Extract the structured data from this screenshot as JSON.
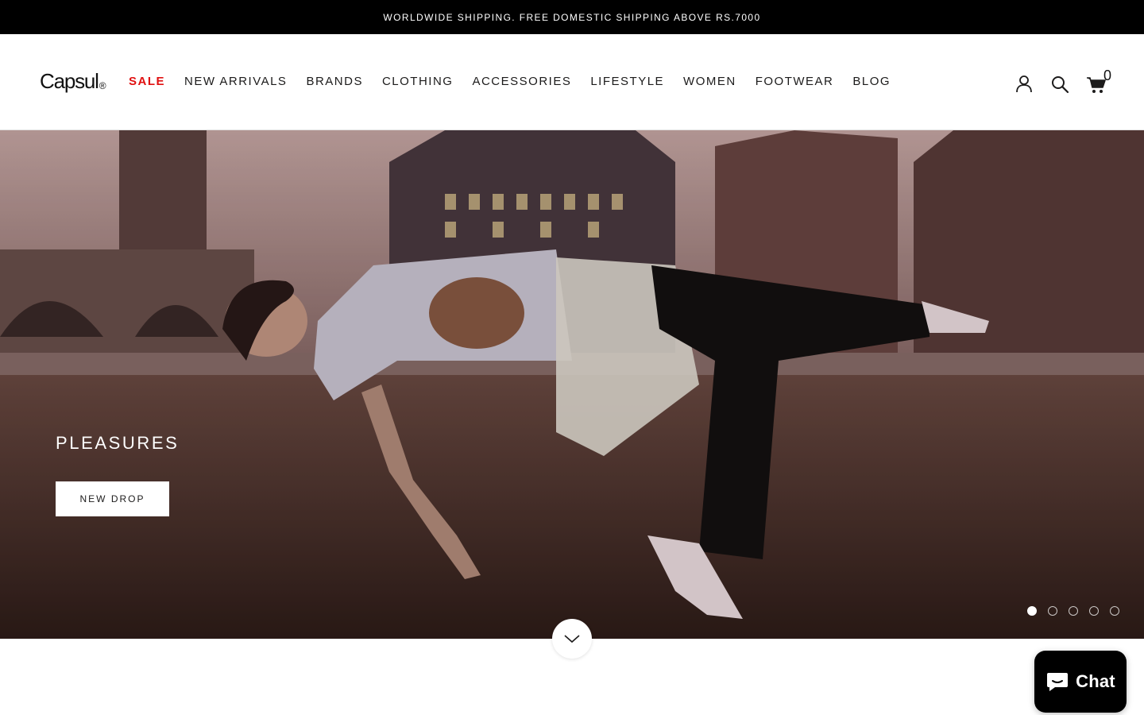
{
  "announcement": {
    "text": "WORLDWIDE SHIPPING. FREE DOMESTIC SHIPPING ABOVE RS.7000"
  },
  "header": {
    "logo": "Capsul",
    "logo_mark": "®",
    "nav": [
      {
        "label": "SALE"
      },
      {
        "label": "NEW ARRIVALS"
      },
      {
        "label": "BRANDS"
      },
      {
        "label": "CLOTHING"
      },
      {
        "label": "ACCESSORIES"
      },
      {
        "label": "LIFESTYLE"
      },
      {
        "label": "WOMEN"
      },
      {
        "label": "FOOTWEAR"
      },
      {
        "label": "BLOG"
      }
    ],
    "icons": [
      "account-icon",
      "search-icon",
      "cart-icon"
    ],
    "cart_count": "0"
  },
  "hero": {
    "title": "PLEASURES",
    "button_label": "NEW DROP",
    "slides_total": 5,
    "active_slide": 1,
    "scroll_icon": "chevron-down-icon"
  },
  "chat": {
    "label": "Chat",
    "icon": "chat-bubble-icon"
  },
  "colors": {
    "announcement_bg": "#000000",
    "sale": "#e01010",
    "text": "#1c1b1b"
  }
}
